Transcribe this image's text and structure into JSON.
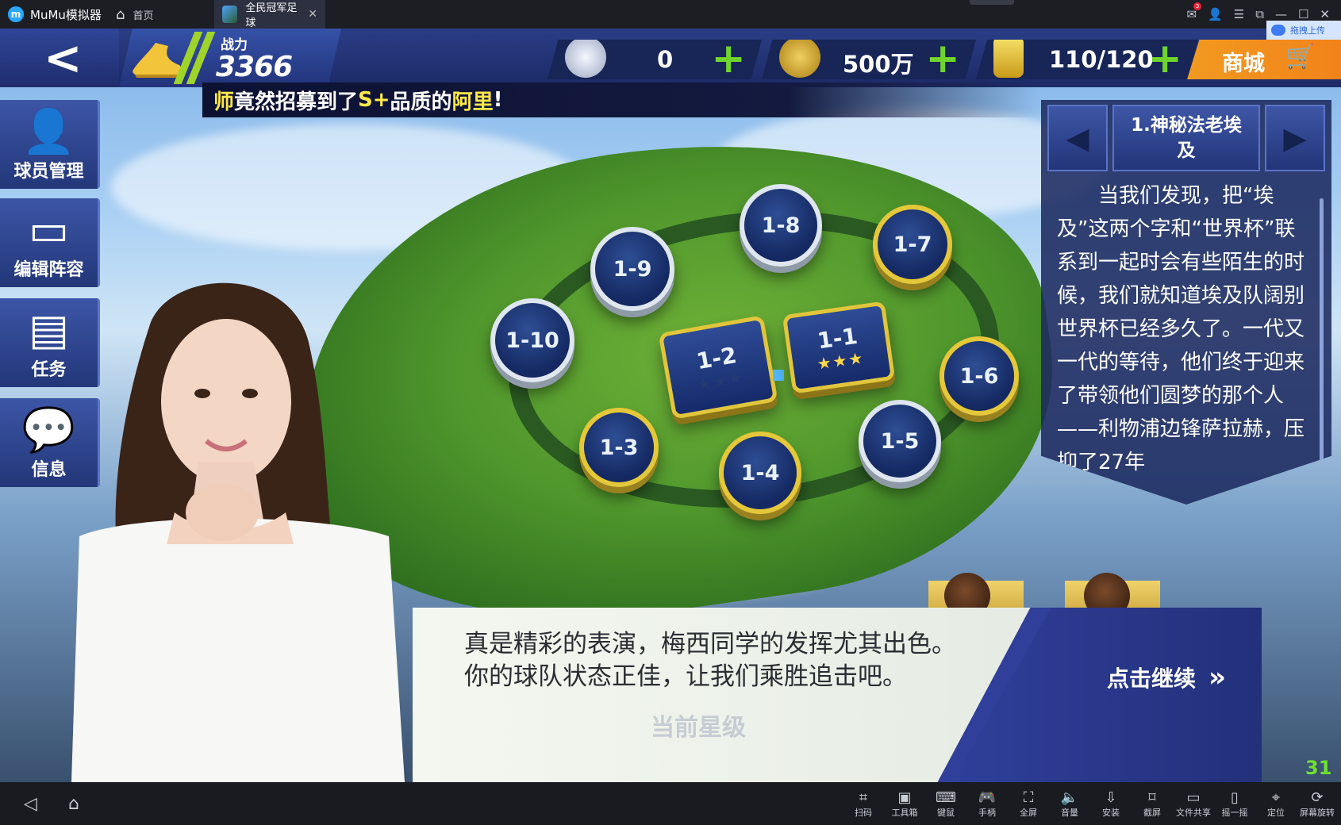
{
  "titlebar": {
    "app_name": "MuMu模拟器",
    "home_tab": "首页",
    "game_tab": "全民冠军足球",
    "upload_label": "拖拽上传"
  },
  "hud": {
    "power_label": "战力",
    "power_value": "3366",
    "diamonds": "0",
    "coins": "500万",
    "energy": "110/120",
    "shop_label": "商城"
  },
  "announcement": {
    "part1": "师",
    "part2": " 竟然招募到了 ",
    "quality": "S+",
    "part3": " 品质的 ",
    "player": "阿里",
    "part4": " !"
  },
  "side_menu": [
    {
      "label": "球员管理",
      "icon": "person-icon"
    },
    {
      "label": "编辑阵容",
      "icon": "pitch-icon"
    },
    {
      "label": "任务",
      "icon": "calendar-icon"
    },
    {
      "label": "信息",
      "icon": "chat-icon"
    }
  ],
  "levels": {
    "l1": {
      "label": "1-1",
      "stars": 3
    },
    "l2": {
      "label": "1-2",
      "stars": 0
    },
    "l3": "1-3",
    "l4": "1-4",
    "l5": "1-5",
    "l6": "1-6",
    "l7": "1-7",
    "l8": "1-8",
    "l9": "1-9",
    "l10": "1-10"
  },
  "chapter": {
    "title": "1.神秘法老埃及",
    "text": "当我们发现，把“埃及”这两个字和“世界杯”联系到一起时会有些陌生的时候，我们就知道埃及队阔别世界杯已经多久了。一代又一代的等待，他们终于迎来了带领他们圆梦的那个人——利物浦边锋萨拉赫，压抑了27年"
  },
  "dialog": {
    "text": "真是精彩的表演，梅西同学的发挥尤其出色。你的球队状态正佳，让我们乘胜追击吧。",
    "continue_label": "点击继续",
    "ghost_text": "当前星级"
  },
  "fps": "31",
  "toolbar": [
    {
      "label": "扫码",
      "icon": "scan-icon"
    },
    {
      "label": "工具箱",
      "icon": "toolbox-icon"
    },
    {
      "label": "键鼠",
      "icon": "keyboard-icon"
    },
    {
      "label": "手柄",
      "icon": "gamepad-icon"
    },
    {
      "label": "全屏",
      "icon": "fullscreen-icon"
    },
    {
      "label": "音量",
      "icon": "volume-icon"
    },
    {
      "label": "安装",
      "icon": "apk-icon"
    },
    {
      "label": "截屏",
      "icon": "crop-icon"
    },
    {
      "label": "文件共享",
      "icon": "folder-icon"
    },
    {
      "label": "摇一摇",
      "icon": "shake-icon"
    },
    {
      "label": "定位",
      "icon": "location-icon"
    },
    {
      "label": "屏幕旋转",
      "icon": "rotate-icon"
    }
  ]
}
